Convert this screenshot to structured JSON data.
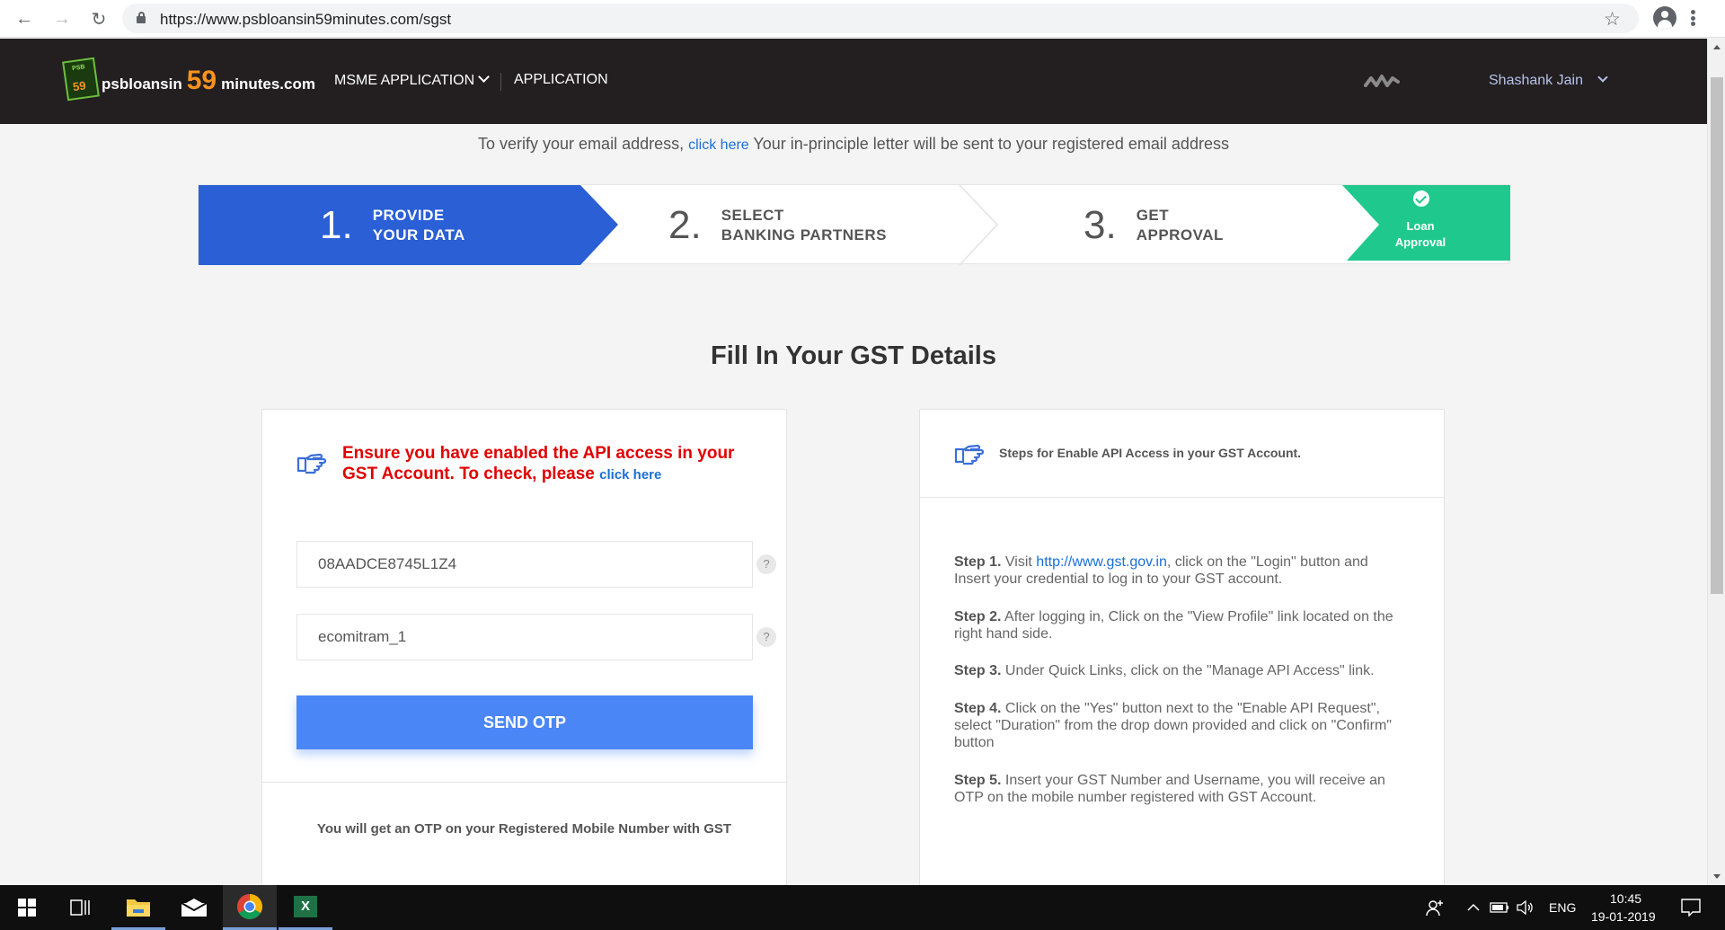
{
  "browser": {
    "url": "https://www.psbloansin59minutes.com/sgst"
  },
  "header": {
    "logo_badge_top": "PSB",
    "logo_badge_num": "59",
    "logo_text_pre": "psbloansin",
    "logo_text_num": "59",
    "logo_text_post": "minutes.com",
    "nav": [
      {
        "label": "MSME APPLICATION"
      },
      {
        "label": "APPLICATION"
      }
    ],
    "user_name": "Shashank Jain"
  },
  "verify": {
    "before": "To verify your email address, ",
    "link": "click here",
    "after": " Your in-principle letter will be sent to your registered email address"
  },
  "stepper": {
    "steps": [
      {
        "num": "1.",
        "line1": "PROVIDE",
        "line2": "YOUR DATA",
        "active": true
      },
      {
        "num": "2.",
        "line1": "SELECT",
        "line2": "BANKING PARTNERS",
        "active": false
      },
      {
        "num": "3.",
        "line1": "GET",
        "line2": "APPROVAL",
        "active": false
      }
    ],
    "approval_line1": "Loan",
    "approval_line2": "Approval"
  },
  "page_title": "Fill In Your GST Details",
  "left_panel": {
    "warning_text": "Ensure you have enabled the API access in your GST Account. To check, please",
    "warning_link": "click here",
    "gstin_value": "08AADCE8745L1Z4",
    "username_value": "ecomitram_1",
    "help_glyph": "?",
    "send_otp_label": "SEND OTP",
    "otp_note": "You will get an OTP on your Registered Mobile Number with GST"
  },
  "right_panel": {
    "heading": "Steps for Enable API Access in your GST Account.",
    "steps": [
      {
        "label": "Step 1.",
        "pre": " Visit ",
        "link": "http://www.gst.gov.in",
        "text": ", click on the \"Login\" button and Insert your credential to log in to your GST account."
      },
      {
        "label": "Step 2.",
        "pre": "",
        "link": "",
        "text": " After logging in, Click on the \"View Profile\" link located on the right hand side."
      },
      {
        "label": "Step 3.",
        "pre": "",
        "link": "",
        "text": " Under Quick Links, click on the \"Manage API Access\" link."
      },
      {
        "label": "Step 4.",
        "pre": "",
        "link": "",
        "text": " Click on the \"Yes\" button next to the \"Enable API Request\", select \"Duration\" from the drop down provided and click on \"Confirm\" button"
      },
      {
        "label": "Step 5.",
        "pre": "",
        "link": "",
        "text": " Insert your GST Number and Username, you will receive an OTP on the mobile number registered with GST Account."
      }
    ]
  },
  "taskbar": {
    "language": "ENG",
    "time": "10:45",
    "date": "19-01-2019",
    "excel_glyph": "X"
  },
  "colors": {
    "step_active": "#2a5fd6",
    "approval_green": "#1fc98e",
    "header_bg": "#231f20",
    "accent_orange": "#f7941d",
    "otp_button": "#4a86f6",
    "warning_red": "#e00000"
  }
}
